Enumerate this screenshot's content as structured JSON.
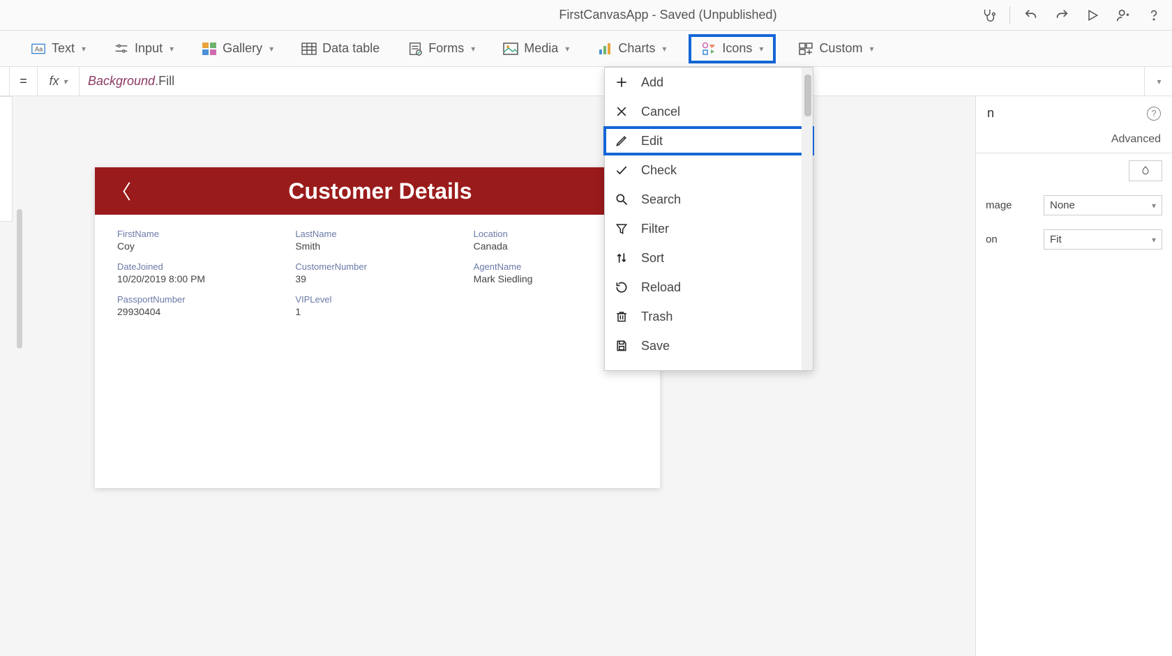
{
  "titlebar": {
    "title": "FirstCanvasApp - Saved (Unpublished)"
  },
  "ribbon": {
    "text": "Text",
    "input": "Input",
    "gallery": "Gallery",
    "datatable": "Data table",
    "forms": "Forms",
    "media": "Media",
    "charts": "Charts",
    "icons": "Icons",
    "custom": "Custom"
  },
  "formula": {
    "eq": "=",
    "fx": "fx",
    "obj": "Background",
    "prop": ".Fill"
  },
  "dropdown": {
    "items": [
      {
        "label": "Add"
      },
      {
        "label": "Cancel"
      },
      {
        "label": "Edit"
      },
      {
        "label": "Check"
      },
      {
        "label": "Search"
      },
      {
        "label": "Filter"
      },
      {
        "label": "Sort"
      },
      {
        "label": "Reload"
      },
      {
        "label": "Trash"
      },
      {
        "label": "Save"
      }
    ]
  },
  "canvas": {
    "title": "Customer Details",
    "fields": {
      "firstname_l": "FirstName",
      "firstname_v": "Coy",
      "lastname_l": "LastName",
      "lastname_v": "Smith",
      "location_l": "Location",
      "location_v": "Canada",
      "datejoined_l": "DateJoined",
      "datejoined_v": "10/20/2019 8:00 PM",
      "custnum_l": "CustomerNumber",
      "custnum_v": "39",
      "agent_l": "AgentName",
      "agent_v": "Mark Siedling",
      "passport_l": "PassportNumber",
      "passport_v": "29930404",
      "vip_l": "VIPLevel",
      "vip_v": "1"
    }
  },
  "rightpane": {
    "section": "n",
    "tab_advanced": "Advanced",
    "bgimage_l": "mage",
    "bgimage_v": "None",
    "imgpos_l": "on",
    "imgpos_v": "Fit"
  }
}
